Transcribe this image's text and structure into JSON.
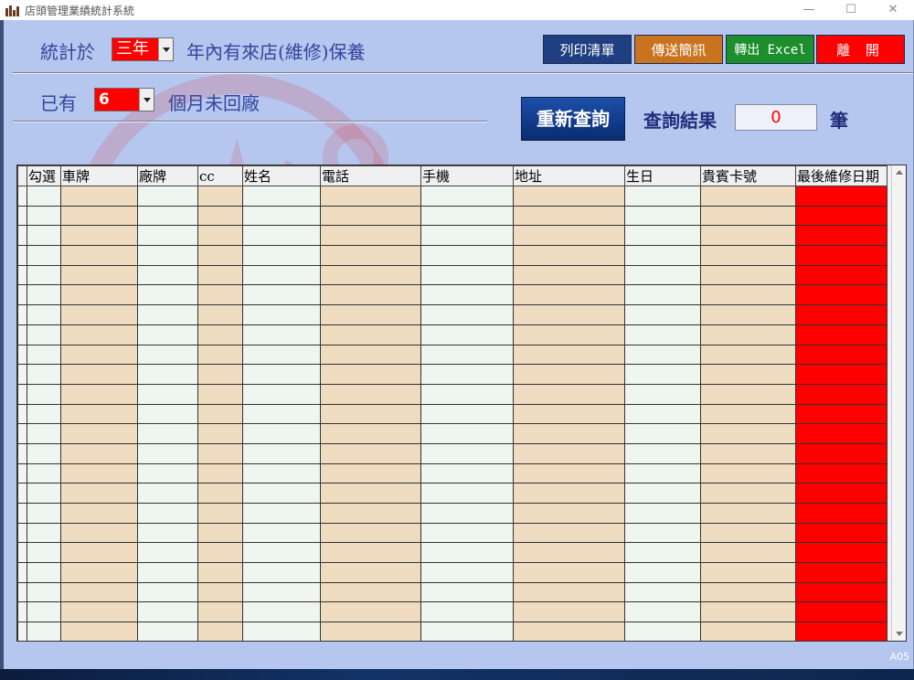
{
  "window": {
    "title": "店頭管理業績統計系統",
    "minimize": "—",
    "maximize": "☐",
    "close": "✕"
  },
  "filters": {
    "stat_label": "統計於",
    "years_value": "三年",
    "years_suffix": "年內有來店(維修)保養",
    "months_prefix": "已有",
    "months_value": "6",
    "months_suffix": "個月未回廠"
  },
  "toolbar": {
    "print": "列印清單",
    "send_sms": "傳送簡訊",
    "export_excel": "轉出 Excel",
    "exit": "離 開",
    "requery": "重新查詢"
  },
  "result": {
    "label": "查詢結果",
    "count": "0",
    "unit": "筆"
  },
  "table": {
    "columns": [
      "",
      "勾選",
      "車牌",
      "廠牌",
      "cc",
      "姓名",
      "電話",
      "手機",
      "地址",
      "生日",
      "貴賓卡號",
      "最後維修日期"
    ],
    "row_count": 23
  },
  "colors": {
    "background": "#b5c6ef",
    "alert": "#ff0000",
    "col_light": "#eff6ef",
    "col_tan": "#f0dcc0"
  },
  "footer": {
    "form_code": "A05"
  }
}
